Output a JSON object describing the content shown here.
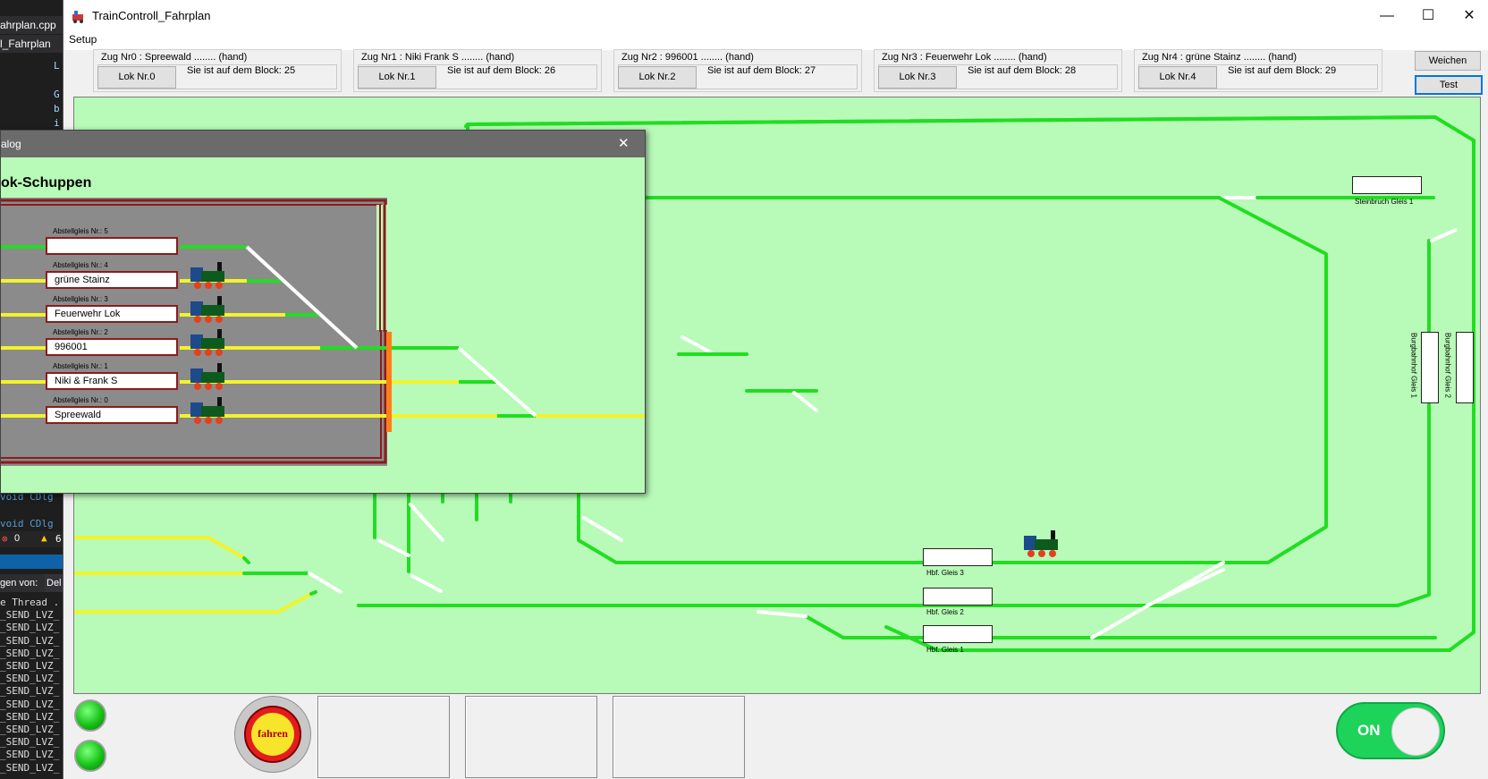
{
  "ide": {
    "tabs": [
      "ahrplan.cpp",
      "l_Fahrplan"
    ],
    "code_lines": [
      "L",
      "G",
      "b",
      "i"
    ],
    "code_lower": [
      "void CDlg",
      "void CDlg"
    ],
    "errors": "0",
    "warnings": "6",
    "output_label": "gen von:",
    "output_combo": "Del",
    "output_lines": [
      "e Thread .",
      "_SEND_LVZ_",
      "_SEND_LVZ_",
      "_SEND_LVZ_",
      "_SEND_LVZ_",
      "_SEND_LVZ_",
      "_SEND_LVZ_",
      "_SEND_LVZ_",
      "_SEND_LVZ_",
      "_SEND_LVZ_",
      "_SEND_LVZ_",
      "_SEND_LVZ_",
      "_SEND_LVZ_",
      "_SEND_LVZ_"
    ]
  },
  "window": {
    "title": "TrainControll_Fahrplan",
    "minimize": "—",
    "maximize": "☐",
    "close": "✕",
    "menu_setup": "Setup"
  },
  "zuege": [
    {
      "header": "Zug Nr0 :  Spreewald ........ (hand)",
      "lok": "Lok  Nr.0",
      "block": "Sie ist auf dem Block: 25"
    },
    {
      "header": "Zug Nr1 :  Niki  Frank S ........ (hand)",
      "lok": "Lok  Nr.1",
      "block": "Sie ist auf dem Block: 26"
    },
    {
      "header": "Zug Nr2 :  996001 ........ (hand)",
      "lok": "Lok  Nr.2",
      "block": "Sie ist auf dem Block: 27"
    },
    {
      "header": "Zug Nr3 :  Feuerwehr Lok ........ (hand)",
      "lok": "Lok  Nr.3",
      "block": "Sie ist auf dem Block: 28"
    },
    {
      "header": "Zug Nr4 :  grüne Stainz ........ (hand)",
      "lok": "Lok  Nr.4",
      "block": "Sie ist auf dem Block: 29"
    }
  ],
  "buttons": {
    "weichen": "Weichen",
    "test": "Test"
  },
  "gleise": {
    "steinbruch": "Steinbruch Gleis 1",
    "burg1": "Burgbahnhof Gleis 1",
    "burg2": "Burgbahnhof Gleis 2",
    "hbf3": "Hbf. Gleis 3",
    "hbf2": "Hbf. Gleis 2",
    "hbf1": "Hbf. Gleis 1"
  },
  "dialog": {
    "title": "alog",
    "close": "✕",
    "heading": "ok-Schuppen",
    "slots": [
      {
        "label": "Abstellgleis Nr.: 5",
        "value": ""
      },
      {
        "label": "Abstellgleis Nr.: 4",
        "value": "grüne Stainz"
      },
      {
        "label": "Abstellgleis Nr.: 3",
        "value": "Feuerwehr Lok"
      },
      {
        "label": "Abstellgleis Nr.: 2",
        "value": "996001"
      },
      {
        "label": "Abstellgleis Nr.: 1",
        "value": "Niki & Frank S"
      },
      {
        "label": "Abstellgleis Nr.: 0",
        "value": "Spreewald"
      }
    ]
  },
  "bottom": {
    "fahren": "fahren",
    "power": "ON"
  },
  "colors": {
    "track_green": "#22dd22",
    "track_yellow": "#f3f32b",
    "panel_bg": "#b8fab8",
    "shed_border": "#8b1c1c"
  }
}
